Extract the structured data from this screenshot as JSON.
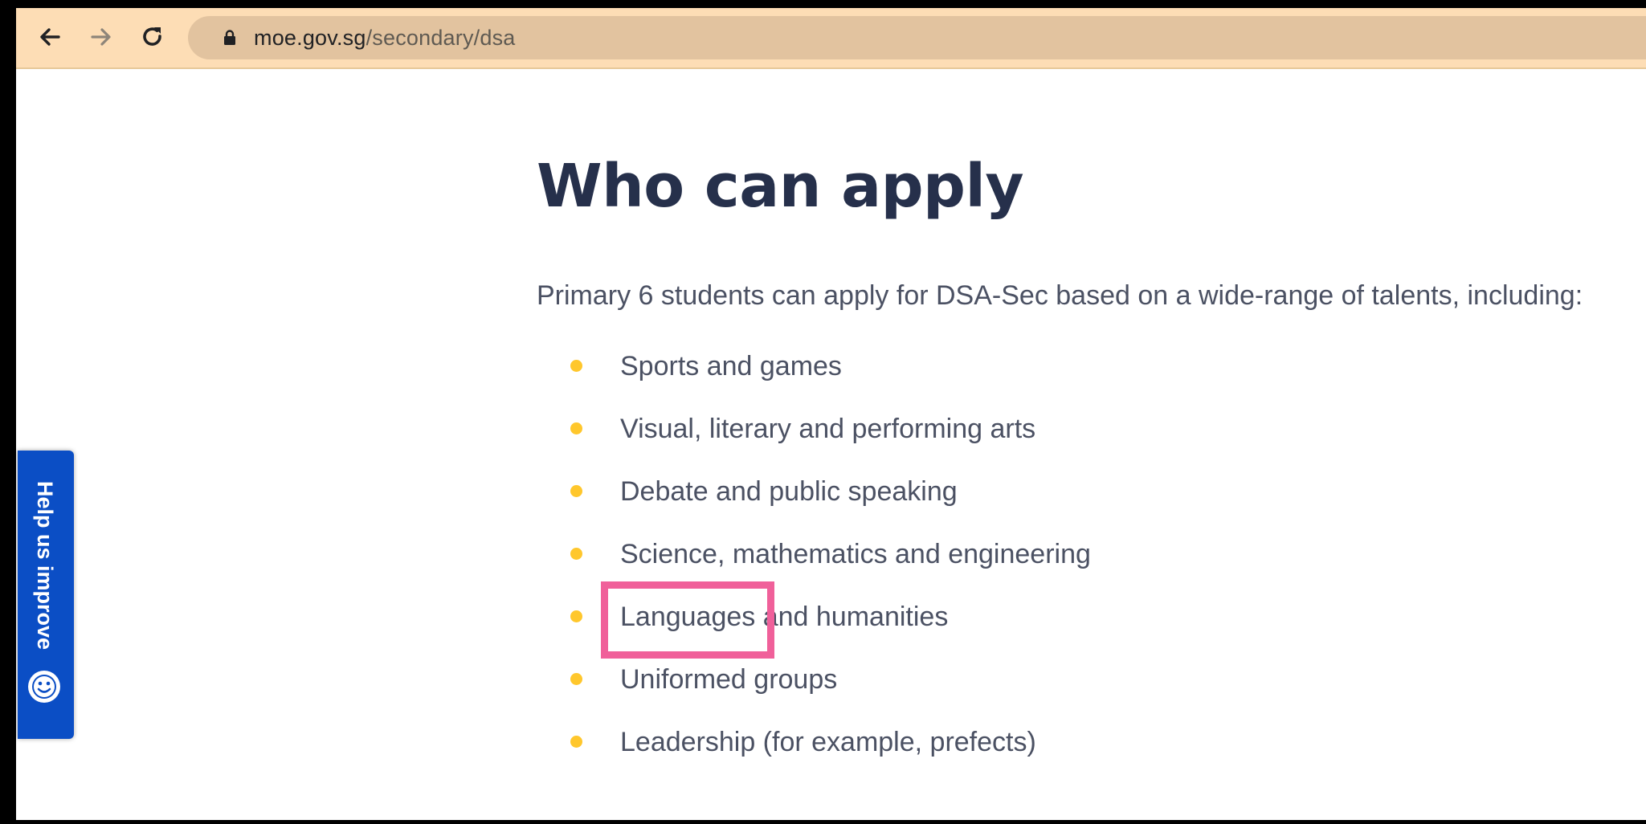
{
  "browser": {
    "url_host": "moe.gov.sg",
    "url_path": "/secondary/dsa",
    "toolbar_color": "#fdddb5",
    "address_bar_color": "#e2c39f"
  },
  "page": {
    "title": "Who can apply",
    "intro": "Primary 6 students can apply for DSA-Sec based on a wide-range of talents, including:",
    "talents": [
      "Sports and games",
      "Visual, literary and performing arts",
      "Debate and public speaking",
      "Science, mathematics and engineering",
      "Languages and humanities",
      "Uniformed groups",
      "Leadership (for example, prefects)"
    ],
    "title_color": "#26304b",
    "text_color": "#4b5163",
    "bullet_color": "#ffc72c"
  },
  "feedback": {
    "label": "Help us improve",
    "icon": "smiley-icon",
    "color": "#0b4ec5"
  },
  "annotation": {
    "color": "#f0609a"
  },
  "icons": {
    "back": "arrow-left-icon",
    "forward": "arrow-right-icon",
    "reload": "reload-icon",
    "lock": "lock-icon"
  }
}
